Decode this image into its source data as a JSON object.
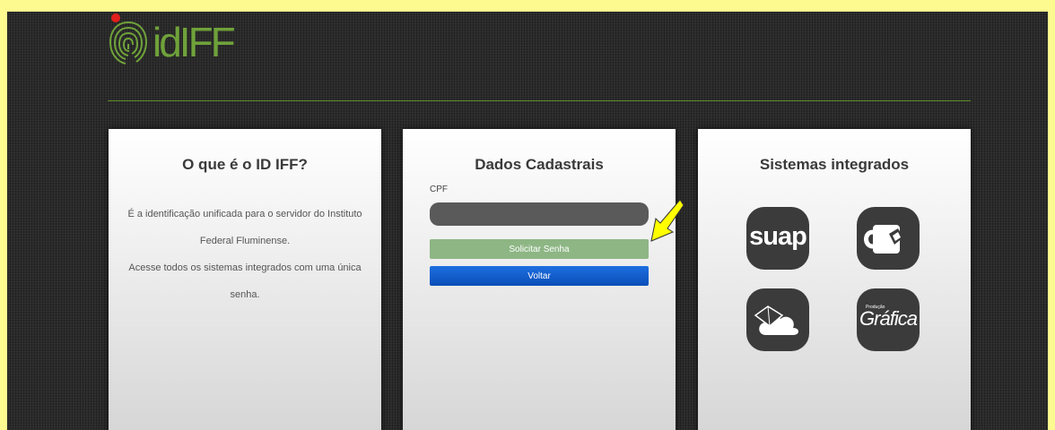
{
  "logo": {
    "text": "idIFF",
    "icon": "fingerprint-icon",
    "brand_color": "#6fa23a",
    "dot_color": "#e0201c"
  },
  "about": {
    "title": "O que é o ID IFF?",
    "paragraph1": "É a identificação unificada para o servidor do Instituto Federal Fluminense.",
    "paragraph2": "Acesse todos os sistemas integrados com uma única senha."
  },
  "form": {
    "title": "Dados Cadastrais",
    "cpf_label": "CPF",
    "cpf_value": "",
    "request_button": "Solicitar Senha",
    "back_button": "Voltar"
  },
  "systems": {
    "title": "Sistemas integrados",
    "items": [
      {
        "label": "suap",
        "icon": "suap-icon"
      },
      {
        "label": "",
        "icon": "mug-icon"
      },
      {
        "label": "",
        "icon": "cloud-box-icon"
      },
      {
        "label": "Gráfica",
        "sublabel": "Produção",
        "icon": "grafica-icon"
      }
    ]
  },
  "annotation": {
    "icon": "yellow-arrow-icon",
    "color": "#ffff00"
  }
}
